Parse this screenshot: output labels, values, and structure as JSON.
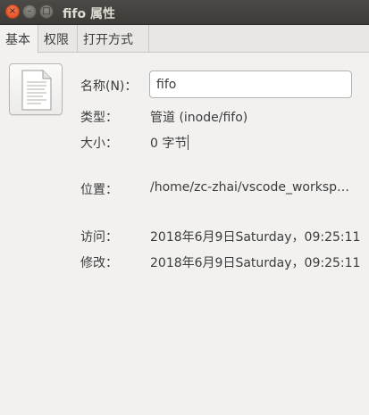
{
  "window": {
    "title": "fifo 属性",
    "controls": {
      "close": "×",
      "minimize": "–",
      "maximize": "□"
    }
  },
  "tabs": [
    {
      "label": "基本",
      "active": true
    },
    {
      "label": "权限",
      "active": false
    },
    {
      "label": "打开方式",
      "active": false
    }
  ],
  "icon": {
    "name": "text-file-icon"
  },
  "properties": {
    "name_label": "名称(N)：",
    "name_value": "fifo",
    "type_label": "类型：",
    "type_value": "管道 (inode/fifo)",
    "size_label": "大小：",
    "size_value": "0 字节",
    "location_label": "位置：",
    "location_value": "/home/zc-zhai/vscode_worksp…",
    "accessed_label": "访问：",
    "accessed_value": "2018年6月9日Saturday，09:25:11",
    "modified_label": "修改：",
    "modified_value": "2018年6月9日Saturday，09:25:11"
  }
}
